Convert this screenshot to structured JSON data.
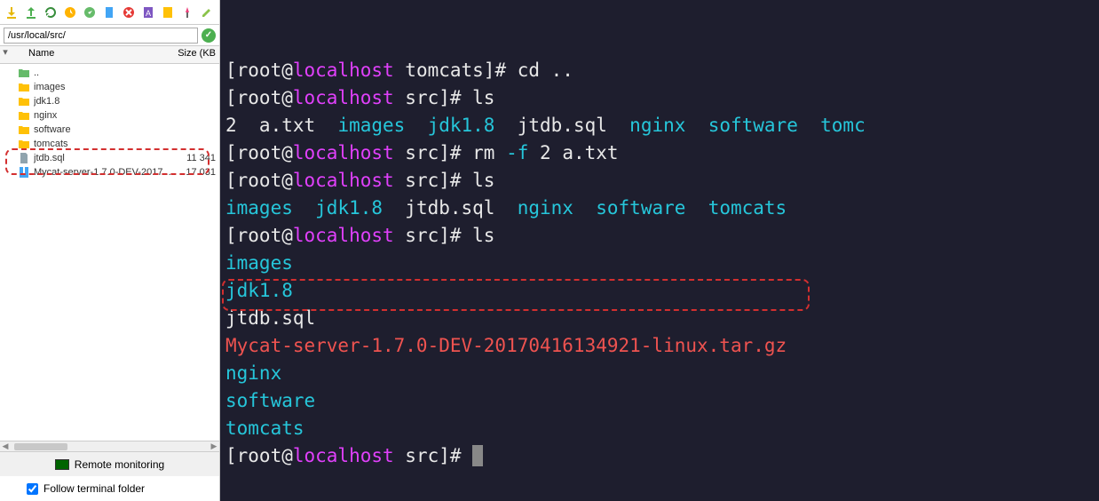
{
  "sidebar": {
    "path": "/usr/local/src/",
    "columns": {
      "name": "Name",
      "size": "Size (KB"
    },
    "items": [
      {
        "type": "up",
        "label": ".."
      },
      {
        "type": "folder",
        "label": "images"
      },
      {
        "type": "folder",
        "label": "jdk1.8"
      },
      {
        "type": "folder",
        "label": "nginx"
      },
      {
        "type": "folder",
        "label": "software"
      },
      {
        "type": "folder",
        "label": "tomcats"
      },
      {
        "type": "file",
        "label": "jtdb.sql",
        "size": "11 341"
      },
      {
        "type": "archive",
        "label": "Mycat-server-1.7.0-DEV-2017...",
        "size": "17 031"
      }
    ],
    "remote": "Remote monitoring",
    "follow": "Follow terminal folder",
    "follow_checked": true
  },
  "terminal": {
    "lines": [
      {
        "segments": [
          {
            "t": "[root@",
            "c": "white"
          },
          {
            "t": "localhost",
            "c": "magenta"
          },
          {
            "t": " tomcats]# cd ..",
            "c": "white"
          }
        ]
      },
      {
        "segments": [
          {
            "t": "[root@",
            "c": "white"
          },
          {
            "t": "localhost",
            "c": "magenta"
          },
          {
            "t": " src]# ls",
            "c": "white"
          }
        ]
      },
      {
        "segments": [
          {
            "t": "2  a.txt  ",
            "c": "white"
          },
          {
            "t": "images",
            "c": "cyan"
          },
          {
            "t": "  ",
            "c": "white"
          },
          {
            "t": "jdk1.8",
            "c": "cyan"
          },
          {
            "t": "  jtdb.sql  ",
            "c": "white"
          },
          {
            "t": "nginx",
            "c": "cyan"
          },
          {
            "t": "  ",
            "c": "white"
          },
          {
            "t": "software",
            "c": "cyan"
          },
          {
            "t": "  ",
            "c": "white"
          },
          {
            "t": "tomc",
            "c": "cyan"
          }
        ]
      },
      {
        "segments": [
          {
            "t": "[root@",
            "c": "white"
          },
          {
            "t": "localhost",
            "c": "magenta"
          },
          {
            "t": " src]# rm ",
            "c": "white"
          },
          {
            "t": "-f",
            "c": "cyan"
          },
          {
            "t": " 2 a.txt",
            "c": "white"
          }
        ]
      },
      {
        "segments": [
          {
            "t": "[root@",
            "c": "white"
          },
          {
            "t": "localhost",
            "c": "magenta"
          },
          {
            "t": " src]# ls",
            "c": "white"
          }
        ]
      },
      {
        "segments": [
          {
            "t": "images",
            "c": "cyan"
          },
          {
            "t": "  ",
            "c": "white"
          },
          {
            "t": "jdk1.8",
            "c": "cyan"
          },
          {
            "t": "  jtdb.sql  ",
            "c": "white"
          },
          {
            "t": "nginx",
            "c": "cyan"
          },
          {
            "t": "  ",
            "c": "white"
          },
          {
            "t": "software",
            "c": "cyan"
          },
          {
            "t": "  ",
            "c": "white"
          },
          {
            "t": "tomcats",
            "c": "cyan"
          }
        ]
      },
      {
        "segments": [
          {
            "t": "[root@",
            "c": "white"
          },
          {
            "t": "localhost",
            "c": "magenta"
          },
          {
            "t": " src]# ls",
            "c": "white"
          }
        ]
      },
      {
        "segments": [
          {
            "t": "images",
            "c": "cyan"
          }
        ]
      },
      {
        "segments": [
          {
            "t": "jdk1.8",
            "c": "cyan"
          }
        ]
      },
      {
        "segments": [
          {
            "t": "jtdb.sql",
            "c": "white"
          }
        ]
      },
      {
        "segments": [
          {
            "t": "Mycat-server-1.7.0-DEV-20170416134921-linux.tar.gz",
            "c": "red"
          }
        ]
      },
      {
        "segments": [
          {
            "t": "nginx",
            "c": "cyan"
          }
        ]
      },
      {
        "segments": [
          {
            "t": "software",
            "c": "cyan"
          }
        ]
      },
      {
        "segments": [
          {
            "t": "tomcats",
            "c": "cyan"
          }
        ]
      },
      {
        "segments": [
          {
            "t": "[root@",
            "c": "white"
          },
          {
            "t": "localhost",
            "c": "magenta"
          },
          {
            "t": " src]# ",
            "c": "white"
          }
        ],
        "cursor": true
      }
    ]
  },
  "toolbar_icons": [
    "download-icon",
    "upload-icon",
    "refresh-icon",
    "reconnect-icon",
    "sync-icon",
    "newfile-icon",
    "close-icon",
    "script-icon",
    "mark-icon",
    "pin-icon",
    "edit-icon"
  ]
}
